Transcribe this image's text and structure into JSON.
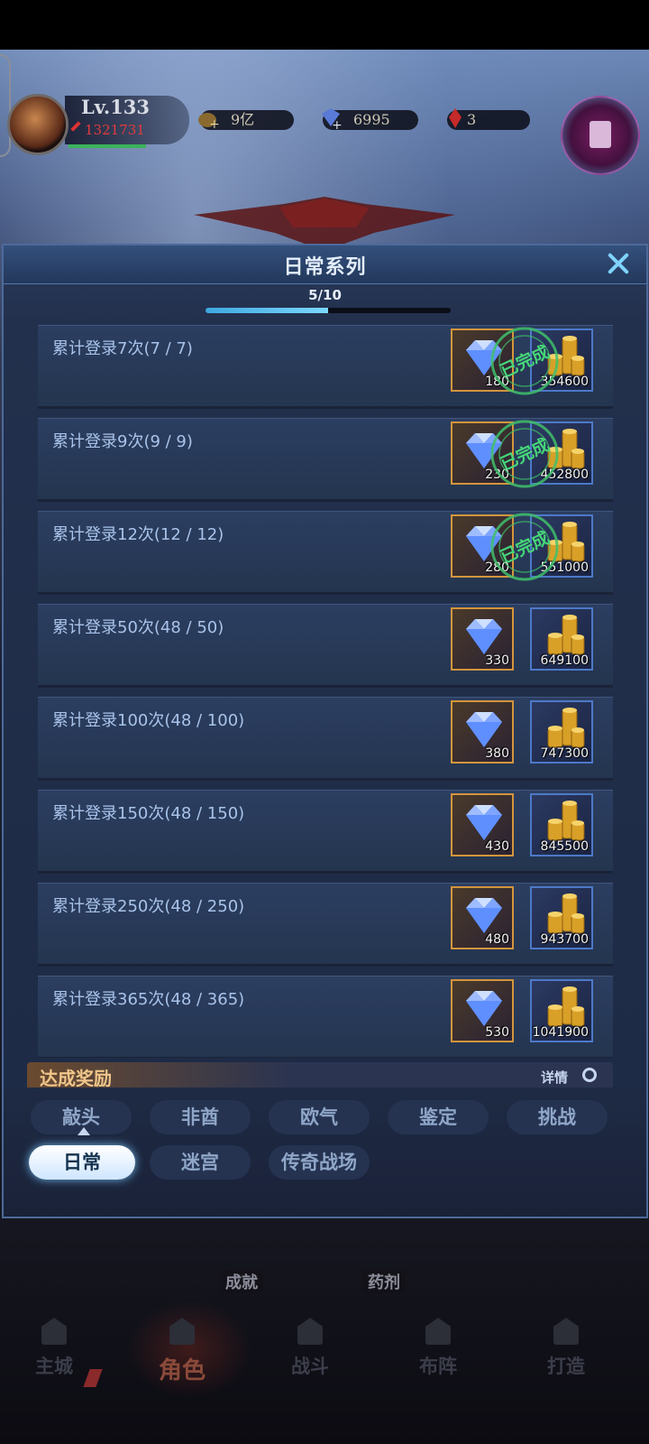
{
  "hud": {
    "level": "Lv.133",
    "power": "1321731",
    "gold": "9亿",
    "diamonds": "6995",
    "rubies": "3"
  },
  "modal": {
    "title": "日常系列",
    "progress": "5/10",
    "progress_fraction": 0.5
  },
  "tasks": [
    {
      "label": "累计登录7次(7 / 7)",
      "gem_qty": "180",
      "gold_qty": "354600",
      "completed": true
    },
    {
      "label": "累计登录9次(9 / 9)",
      "gem_qty": "230",
      "gold_qty": "452800",
      "completed": true
    },
    {
      "label": "累计登录12次(12 / 12)",
      "gem_qty": "280",
      "gold_qty": "551000",
      "completed": true
    },
    {
      "label": "累计登录50次(48 / 50)",
      "gem_qty": "330",
      "gold_qty": "649100",
      "completed": false
    },
    {
      "label": "累计登录100次(48 / 100)",
      "gem_qty": "380",
      "gold_qty": "747300",
      "completed": false
    },
    {
      "label": "累计登录150次(48 / 150)",
      "gem_qty": "430",
      "gold_qty": "845500",
      "completed": false
    },
    {
      "label": "累计登录250次(48 / 250)",
      "gem_qty": "480",
      "gold_qty": "943700",
      "completed": false
    },
    {
      "label": "累计登录365次(48 / 365)",
      "gem_qty": "530",
      "gold_qty": "1041900",
      "completed": false
    }
  ],
  "stamp_text": "已完成",
  "achievement": {
    "title": "达成奖励",
    "detail": "详情"
  },
  "tabs_row1": [
    "敲头",
    "非酋",
    "欧气",
    "鉴定",
    "挑战"
  ],
  "tabs_row2": [
    "日常",
    "迷宫",
    "传奇战场"
  ],
  "active_tab": "日常",
  "background": {
    "label_left": "成就",
    "label_right": "药剂"
  },
  "bottom_nav": [
    "主城",
    "角色",
    "战斗",
    "布阵",
    "打造"
  ],
  "colors": {
    "accent": "#7fd3ff",
    "gem_border": "#d3953c",
    "gold_border": "#4c79c8",
    "stamp": "#3fbf6a"
  }
}
